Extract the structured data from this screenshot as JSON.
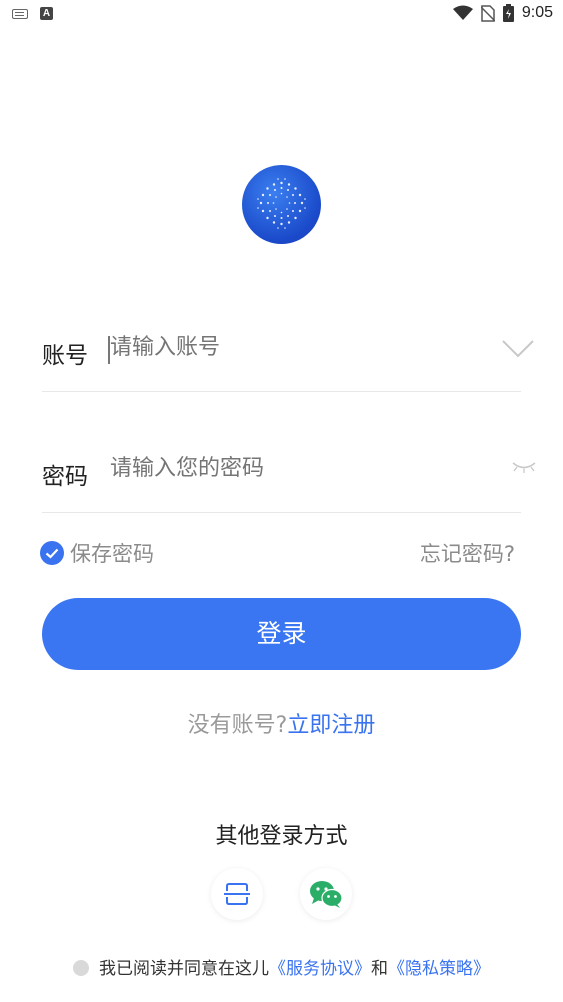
{
  "status_bar": {
    "time": "9:05",
    "app_badge": "A"
  },
  "account": {
    "label": "账号",
    "placeholder": "请输入账号"
  },
  "password": {
    "label": "密码",
    "placeholder": "请输入您的密码"
  },
  "options": {
    "remember_label": "保存密码",
    "forgot_label": "忘记密码?"
  },
  "login_button": "登录",
  "register": {
    "prompt": "没有账号?",
    "link": "立即注册"
  },
  "other_login": {
    "title": "其他登录方式",
    "methods": [
      "scan-icon",
      "wechat-icon"
    ]
  },
  "agreement": {
    "text": "我已阅读并同意在这儿",
    "terms": "《服务协议》",
    "and": "和",
    "privacy": "《隐私策略》"
  },
  "colors": {
    "primary": "#3a76f2",
    "link": "#3a73ef",
    "wechat": "#2aae67"
  }
}
